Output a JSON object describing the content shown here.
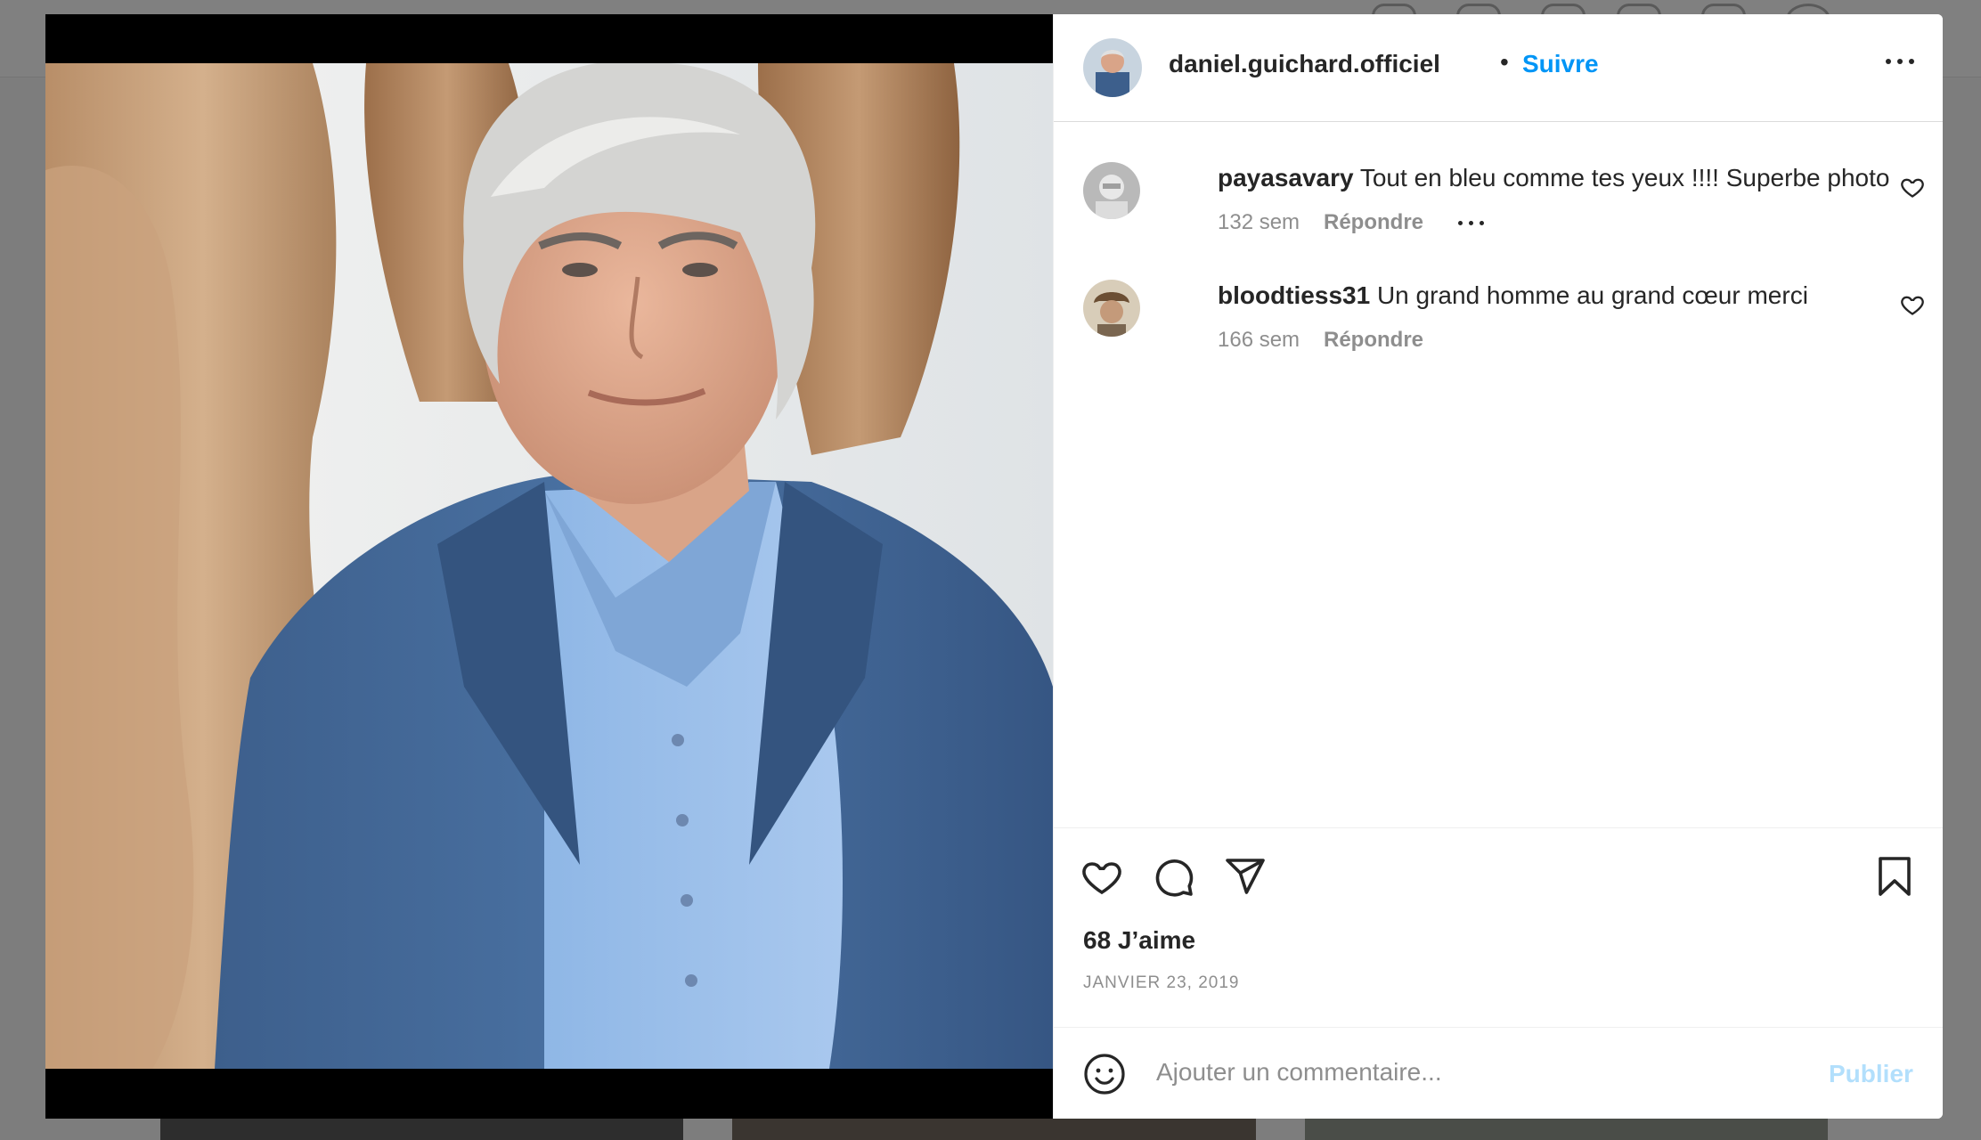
{
  "post": {
    "author": "daniel.guichard.officiel",
    "separator": "•",
    "follow_label": "Suivre",
    "likes": "68 J’aime",
    "date": "JANVIER 23, 2019"
  },
  "comments": [
    {
      "username": "payasavary",
      "text": "Tout en bleu comme tes yeux !!!! Superbe photo",
      "time": "132 sem",
      "reply_label": "Répondre"
    },
    {
      "username": "bloodtiess31",
      "text": "Un grand homme au grand cœur merci",
      "time": "166 sem",
      "reply_label": "Répondre"
    }
  ],
  "composer": {
    "placeholder": "Ajouter un commentaire...",
    "publish_label": "Publier"
  },
  "icons": [
    "more-icon",
    "heart-icon",
    "comment-icon",
    "share-icon",
    "bookmark-icon",
    "emoji-icon"
  ],
  "colors": {
    "link": "#0095f6",
    "publish_disabled": "#b2dffc",
    "text": "#262626",
    "muted": "#8e8e8e"
  }
}
